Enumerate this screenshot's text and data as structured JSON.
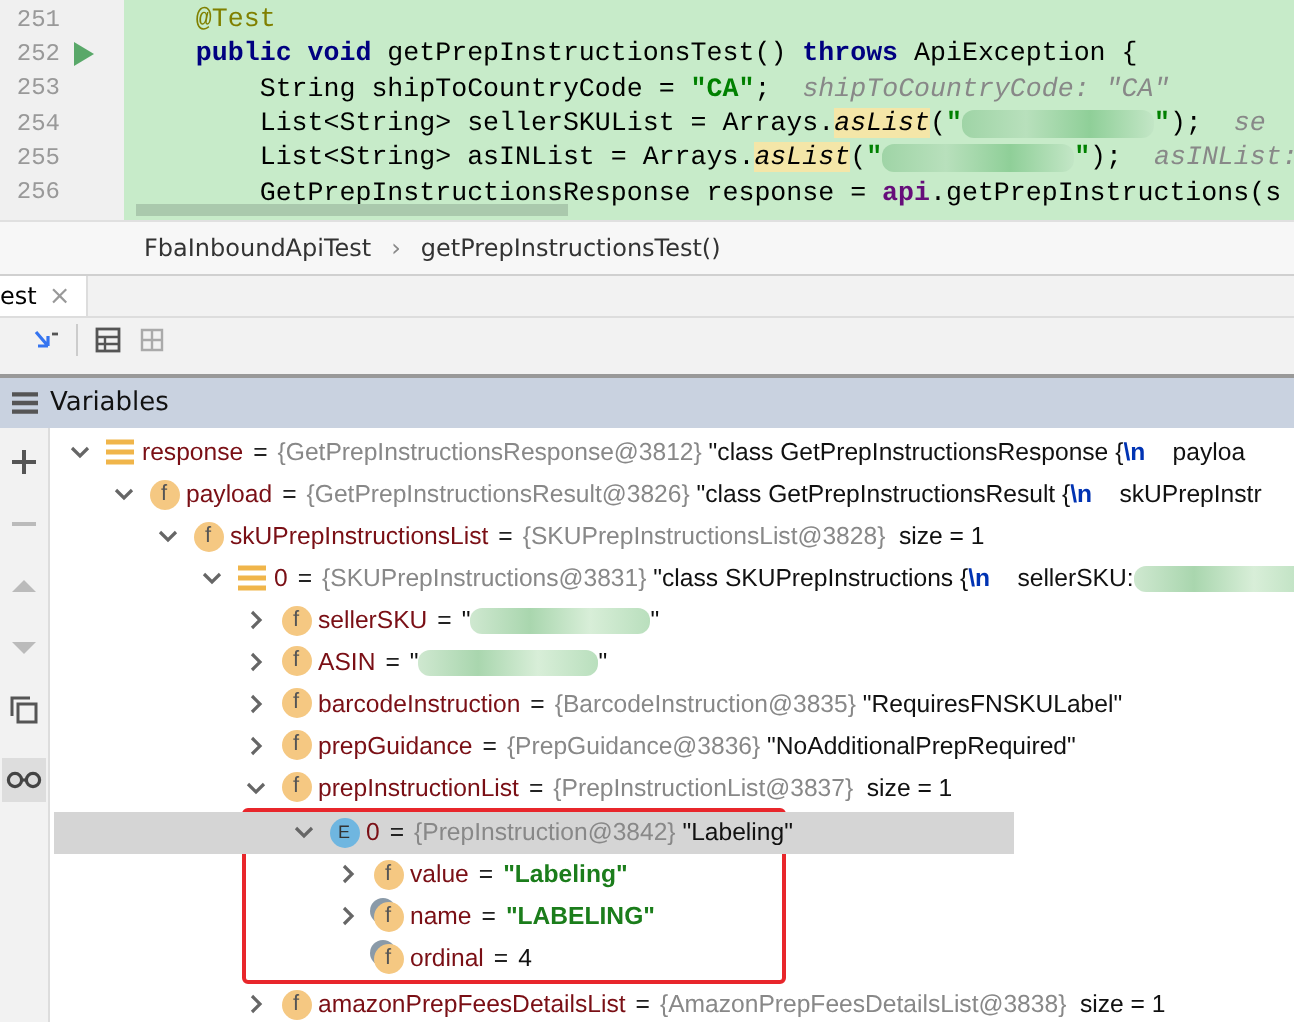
{
  "editor": {
    "lines": [
      {
        "number": "251",
        "run": false,
        "code": [
          {
            "kind": "annotation",
            "text": "    @Test"
          }
        ]
      },
      {
        "number": "252",
        "run": true,
        "code": [
          {
            "kind": "keyword",
            "text": "    public void"
          },
          {
            "kind": "plain",
            "text": " getPrepInstructionsTest() "
          },
          {
            "kind": "keyword",
            "text": "throws"
          },
          {
            "kind": "plain",
            "text": " ApiException {"
          }
        ]
      },
      {
        "number": "253",
        "run": false,
        "code": [
          {
            "kind": "plain",
            "text": "        String shipToCountryCode = "
          },
          {
            "kind": "string",
            "text": "\"CA\""
          },
          {
            "kind": "plain",
            "text": ";"
          }
        ],
        "hint": "shipToCountryCode: \"CA\""
      },
      {
        "number": "254",
        "run": false,
        "code": [
          {
            "kind": "plain",
            "text": "        List<String> sellerSKUList = Arrays."
          },
          {
            "kind": "call",
            "text": "asList"
          },
          {
            "kind": "plain",
            "text": "("
          },
          {
            "kind": "string",
            "text": "\""
          },
          {
            "kind": "redacted"
          },
          {
            "kind": "string",
            "text": "\""
          },
          {
            "kind": "plain",
            "text": ");"
          }
        ],
        "hint": "se"
      },
      {
        "number": "255",
        "run": false,
        "code": [
          {
            "kind": "plain",
            "text": "        List<String> asINList = Arrays."
          },
          {
            "kind": "call",
            "text": "asList"
          },
          {
            "kind": "plain",
            "text": "("
          },
          {
            "kind": "string",
            "text": "\""
          },
          {
            "kind": "redacted"
          },
          {
            "kind": "string",
            "text": "\""
          },
          {
            "kind": "plain",
            "text": ");"
          }
        ],
        "hint": "asINList:"
      },
      {
        "number": "256",
        "run": false,
        "code": [
          {
            "kind": "plain",
            "text": "        GetPrepInstructionsResponse response = "
          },
          {
            "kind": "field",
            "text": "api"
          },
          {
            "kind": "plain",
            "text": ".getPrepInstructions(s"
          }
        ]
      }
    ]
  },
  "breadcrumbs": [
    "FbaInboundApiTest",
    "getPrepInstructionsTest()"
  ],
  "breadcrumb_separator": "›",
  "tab": {
    "label": "est",
    "close": "×"
  },
  "variables_panel": {
    "title": "Variables",
    "tree": [
      {
        "kind": "list",
        "name": "response",
        "sep": "=",
        "expanded": true,
        "selected": false,
        "highlighted": false,
        "value": [
          {
            "kind": "ref",
            "text": "{GetPrepInstructionsResponse@3812}"
          },
          {
            "kind": "text",
            "text": " \"class GetPrepInstructionsResponse {"
          },
          {
            "kind": "escape",
            "text": "\\n"
          },
          {
            "kind": "text",
            "text": "    payloa"
          }
        ],
        "children": [
          {
            "kind": "field",
            "badge": "f",
            "name": "payload",
            "sep": "=",
            "expanded": true,
            "selected": false,
            "highlighted": false,
            "value": [
              {
                "kind": "ref",
                "text": "{GetPrepInstructionsResult@3826}"
              },
              {
                "kind": "text",
                "text": " \"class GetPrepInstructionsResult {"
              },
              {
                "kind": "escape",
                "text": "\\n"
              },
              {
                "kind": "text",
                "text": "    skUPrepInstr"
              }
            ],
            "children": [
              {
                "kind": "field",
                "badge": "f",
                "name": "skUPrepInstructionsList",
                "sep": "=",
                "expanded": true,
                "selected": false,
                "highlighted": false,
                "value": [
                  {
                    "kind": "ref",
                    "text": "{SKUPrepInstructionsList@3828}"
                  },
                  {
                    "kind": "text",
                    "text": "  size = 1"
                  }
                ],
                "children": [
                  {
                    "kind": "list",
                    "name": "0",
                    "sep": "=",
                    "expanded": true,
                    "selected": false,
                    "highlighted": false,
                    "value": [
                      {
                        "kind": "ref",
                        "text": "{SKUPrepInstructions@3831}"
                      },
                      {
                        "kind": "text",
                        "text": " \"class SKUPrepInstructions {"
                      },
                      {
                        "kind": "escape",
                        "text": "\\n"
                      },
                      {
                        "kind": "text",
                        "text": "    sellerSKU:"
                      },
                      {
                        "kind": "redacted"
                      }
                    ],
                    "children": [
                      {
                        "kind": "field",
                        "badge": "f",
                        "name": "sellerSKU",
                        "sep": "=",
                        "expanded": false,
                        "selected": false,
                        "highlighted": false,
                        "value": [
                          {
                            "kind": "text",
                            "text": "\""
                          },
                          {
                            "kind": "redacted"
                          },
                          {
                            "kind": "text",
                            "text": "\""
                          }
                        ]
                      },
                      {
                        "kind": "field",
                        "badge": "f",
                        "name": "ASIN",
                        "sep": "=",
                        "expanded": false,
                        "selected": false,
                        "highlighted": false,
                        "value": [
                          {
                            "kind": "text",
                            "text": "\""
                          },
                          {
                            "kind": "redacted"
                          },
                          {
                            "kind": "text",
                            "text": "\""
                          }
                        ]
                      },
                      {
                        "kind": "field",
                        "badge": "f",
                        "name": "barcodeInstruction",
                        "sep": "=",
                        "expanded": false,
                        "selected": false,
                        "highlighted": false,
                        "value": [
                          {
                            "kind": "ref",
                            "text": "{BarcodeInstruction@3835}"
                          },
                          {
                            "kind": "text",
                            "text": " \"RequiresFNSKULabel\""
                          }
                        ]
                      },
                      {
                        "kind": "field",
                        "badge": "f",
                        "name": "prepGuidance",
                        "sep": "=",
                        "expanded": false,
                        "selected": false,
                        "highlighted": false,
                        "value": [
                          {
                            "kind": "ref",
                            "text": "{PrepGuidance@3836}"
                          },
                          {
                            "kind": "text",
                            "text": " \"NoAdditionalPrepRequired\""
                          }
                        ]
                      },
                      {
                        "kind": "field",
                        "badge": "f",
                        "name": "prepInstructionList",
                        "sep": "=",
                        "expanded": true,
                        "selected": false,
                        "highlighted": false,
                        "value": [
                          {
                            "kind": "ref",
                            "text": "{PrepInstructionList@3837}"
                          },
                          {
                            "kind": "text",
                            "text": "  size = 1"
                          }
                        ],
                        "children": [
                          {
                            "kind": "enum",
                            "badge": "E",
                            "name": "0",
                            "sep": "=",
                            "expanded": true,
                            "selected": true,
                            "highlighted": true,
                            "value": [
                              {
                                "kind": "ref",
                                "text": "{PrepInstruction@3842}"
                              },
                              {
                                "kind": "text",
                                "text": " \"Labeling\""
                              }
                            ],
                            "children": [
                              {
                                "kind": "field",
                                "badge": "f",
                                "name": "value",
                                "sep": "=",
                                "expanded": false,
                                "selected": false,
                                "highlighted": false,
                                "value": [
                                  {
                                    "kind": "strval",
                                    "text": "\"Labeling\""
                                  }
                                ]
                              },
                              {
                                "kind": "final",
                                "badge": "f",
                                "name": "name",
                                "sep": "=",
                                "expanded": false,
                                "selected": false,
                                "highlighted": false,
                                "value": [
                                  {
                                    "kind": "strval",
                                    "text": "\"LABELING\""
                                  }
                                ]
                              },
                              {
                                "kind": "final",
                                "badge": "f",
                                "name": "ordinal",
                                "sep": "=",
                                "selected": false,
                                "highlighted": false,
                                "value": [
                                  {
                                    "kind": "text",
                                    "text": "4"
                                  }
                                ]
                              }
                            ]
                          }
                        ]
                      },
                      {
                        "kind": "field",
                        "badge": "f",
                        "name": "amazonPrepFeesDetailsList",
                        "sep": "=",
                        "expanded": false,
                        "selected": false,
                        "highlighted": false,
                        "value": [
                          {
                            "kind": "ref",
                            "text": "{AmazonPrepFeesDetailsList@3838}"
                          },
                          {
                            "kind": "text",
                            "text": "  size = 1"
                          }
                        ]
                      }
                    ]
                  }
                ]
              }
            ]
          }
        ]
      }
    ]
  }
}
